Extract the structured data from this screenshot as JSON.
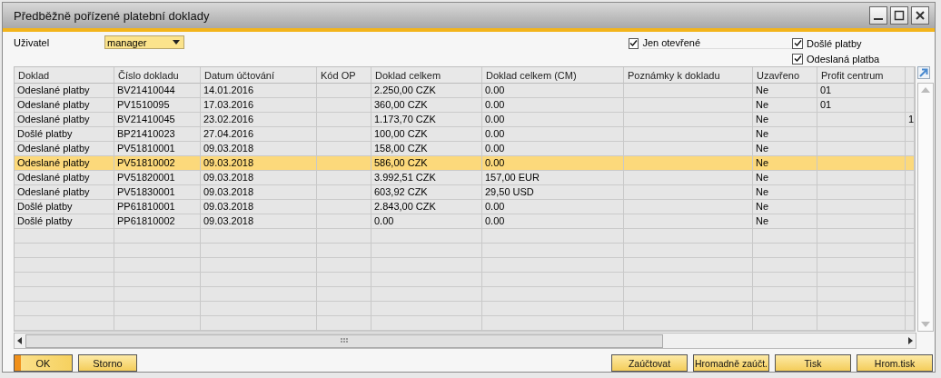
{
  "window": {
    "title": "Předběžně pořízené platební doklady"
  },
  "filters": {
    "user_label": "Uživatel",
    "user_value": "manager",
    "checkboxes": [
      {
        "label": "Jen otevřené",
        "checked": true
      },
      {
        "label": "Došlé platby",
        "checked": true
      },
      {
        "label": "Odeslaná platba",
        "checked": true
      }
    ]
  },
  "table": {
    "columns": [
      "Doklad",
      "Číslo dokladu",
      "Datum účtování",
      "Kód OP",
      "Doklad celkem",
      "Doklad celkem (CM)",
      "Poznámky k dokladu",
      "Uzavřeno",
      "Profit centrum",
      ""
    ],
    "rows": [
      {
        "selected": false,
        "cells": [
          "Odeslané platby",
          "BV21410044",
          "14.01.2016",
          "",
          "2.250,00 CZK",
          "0.00",
          "",
          "Ne",
          "01",
          ""
        ]
      },
      {
        "selected": false,
        "cells": [
          "Odeslané platby",
          "PV1510095",
          "17.03.2016",
          "",
          "360,00 CZK",
          "0.00",
          "",
          "Ne",
          "01",
          ""
        ]
      },
      {
        "selected": false,
        "cells": [
          "Odeslané platby",
          "BV21410045",
          "23.02.2016",
          "",
          "1.173,70 CZK",
          "0.00",
          "",
          "Ne",
          "",
          "1"
        ]
      },
      {
        "selected": false,
        "cells": [
          "Došlé platby",
          "BP21410023",
          "27.04.2016",
          "",
          "100,00 CZK",
          "0.00",
          "",
          "Ne",
          "",
          ""
        ]
      },
      {
        "selected": false,
        "cells": [
          "Odeslané platby",
          "PV51810001",
          "09.03.2018",
          "",
          "158,00 CZK",
          "0.00",
          "",
          "Ne",
          "",
          ""
        ]
      },
      {
        "selected": true,
        "cells": [
          "Odeslané platby",
          "PV51810002",
          "09.03.2018",
          "",
          "586,00 CZK",
          "0.00",
          "",
          "Ne",
          "",
          ""
        ]
      },
      {
        "selected": false,
        "cells": [
          "Odeslané platby",
          "PV51820001",
          "09.03.2018",
          "",
          "3.992,51 CZK",
          "157,00 EUR",
          "",
          "Ne",
          "",
          ""
        ]
      },
      {
        "selected": false,
        "cells": [
          "Odeslané platby",
          "PV51830001",
          "09.03.2018",
          "",
          "603,92 CZK",
          "29,50 USD",
          "",
          "Ne",
          "",
          ""
        ]
      },
      {
        "selected": false,
        "cells": [
          "Došlé platby",
          "PP61810001",
          "09.03.2018",
          "",
          "2.843,00 CZK",
          "0.00",
          "",
          "Ne",
          "",
          ""
        ]
      },
      {
        "selected": false,
        "cells": [
          "Došlé platby",
          "PP61810002",
          "09.03.2018",
          "",
          "0.00",
          "0.00",
          "",
          "Ne",
          "",
          ""
        ]
      }
    ]
  },
  "buttons_left": [
    {
      "label": "OK",
      "kind": "primary"
    },
    {
      "label": "Storno",
      "kind": "normal"
    }
  ],
  "buttons_right": [
    {
      "label": "Zaúčtovat",
      "kind": "normal"
    },
    {
      "label": "Hromadně zaúčt.",
      "kind": "normal"
    },
    {
      "label": "Tisk",
      "kind": "normal"
    },
    {
      "label": "Hrom.tisk",
      "kind": "normal"
    }
  ]
}
